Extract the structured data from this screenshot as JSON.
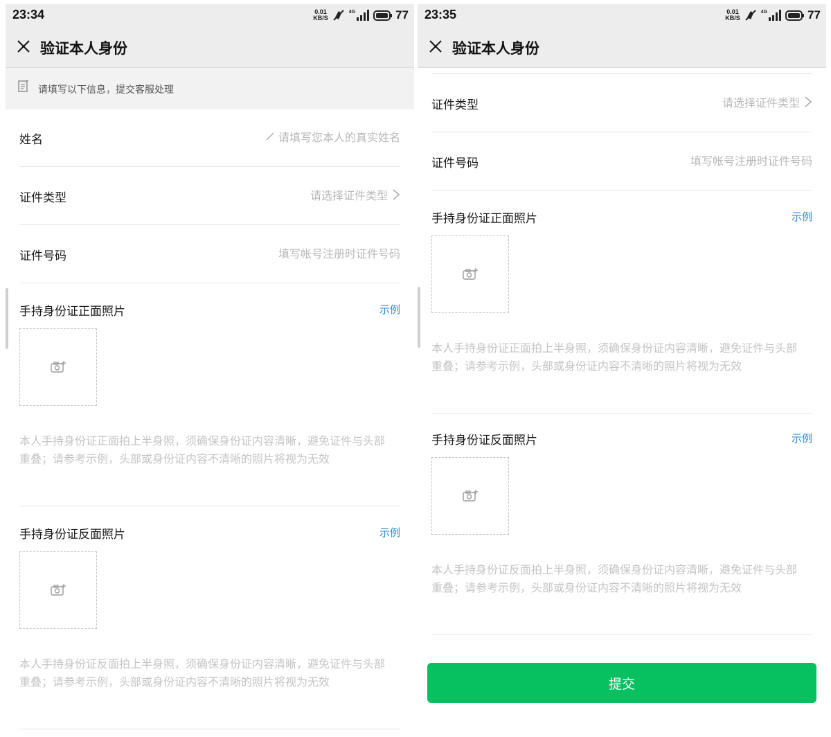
{
  "left": {
    "status": {
      "time": "23:34",
      "speed_top": "0.01",
      "speed_bottom": "KB/S",
      "signal_label": "4G",
      "battery": "77"
    },
    "nav": {
      "title": "验证本人身份"
    },
    "notice": {
      "text": "请填写以下信息，提交客服处理"
    },
    "fields": [
      {
        "label": "姓名",
        "placeholder": "请填写您本人的真实姓名"
      },
      {
        "label": "证件类型",
        "placeholder": "请选择证件类型"
      },
      {
        "label": "证件号码",
        "placeholder": "填写帐号注册时证件号码"
      }
    ],
    "photos": [
      {
        "title": "手持身份证正面照片",
        "example": "示例",
        "hint": "本人手持身份证正面拍上半身照，须确保身份证内容清晰，避免证件与头部重叠；请参考示例，头部或身份证内容不清晰的照片将视为无效"
      },
      {
        "title": "手持身份证反面照片",
        "example": "示例",
        "hint": "本人手持身份证反面拍上半身照，须确保身份证内容清晰，避免证件与头部重叠；请参考示例，头部或身份证内容不清晰的照片将视为无效"
      }
    ]
  },
  "right": {
    "status": {
      "time": "23:35",
      "speed_top": "0.01",
      "speed_bottom": "KB/S",
      "signal_label": "4G",
      "battery": "77"
    },
    "nav": {
      "title": "验证本人身份"
    },
    "fields": [
      {
        "label": "证件类型",
        "placeholder": "请选择证件类型"
      },
      {
        "label": "证件号码",
        "placeholder": "填写帐号注册时证件号码"
      }
    ],
    "photos": [
      {
        "title": "手持身份证正面照片",
        "example": "示例",
        "hint": "本人手持身份证正面拍上半身照，须确保身份证内容清晰，避免证件与头部重叠；请参考示例，头部或身份证内容不清晰的照片将视为无效"
      },
      {
        "title": "手持身份证反面照片",
        "example": "示例",
        "hint": "本人手持身份证反面拍上半身照，须确保身份证内容清晰，避免证件与头部重叠；请参考示例，头部或身份证内容不清晰的照片将视为无效"
      }
    ],
    "submit": {
      "label": "提交"
    }
  },
  "colors": {
    "accent_green": "#07c160",
    "link_blue": "#2f8ad0",
    "placeholder_gray": "#b8b8b8",
    "header_bg": "#ededed"
  },
  "icons": [
    "close-icon",
    "notice-edit-icon",
    "pencil-icon",
    "chevron-right-icon",
    "camera-add-icon",
    "mute-icon",
    "signal-icon",
    "battery-icon"
  ]
}
